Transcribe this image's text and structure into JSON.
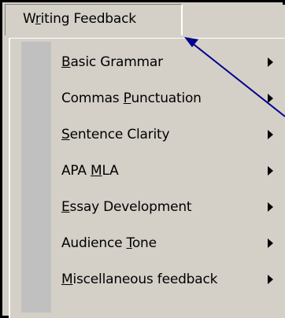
{
  "menu": {
    "title": {
      "before": "W",
      "accel": "r",
      "after": "iting Feedback"
    },
    "items": [
      {
        "before": "",
        "accel": "B",
        "after": "asic Grammar"
      },
      {
        "before": "Commas ",
        "accel": "P",
        "after": "unctuation"
      },
      {
        "before": "",
        "accel": "S",
        "after": "entence Clarity"
      },
      {
        "before": "APA ",
        "accel": "M",
        "after": "LA"
      },
      {
        "before": "",
        "accel": "E",
        "after": "ssay Development"
      },
      {
        "before": "Audience ",
        "accel": "T",
        "after": "one"
      },
      {
        "before": "",
        "accel": "M",
        "after": "iscellaneous feedback"
      }
    ]
  },
  "colors": {
    "menu_face": "#d4d0c8",
    "menu_stripe": "#c0c0c0",
    "frame_border": "#000000",
    "pointer_line": "#00008b"
  },
  "icons": {
    "submenu_arrow": "triangle-right",
    "pointer": "arrow-line"
  }
}
